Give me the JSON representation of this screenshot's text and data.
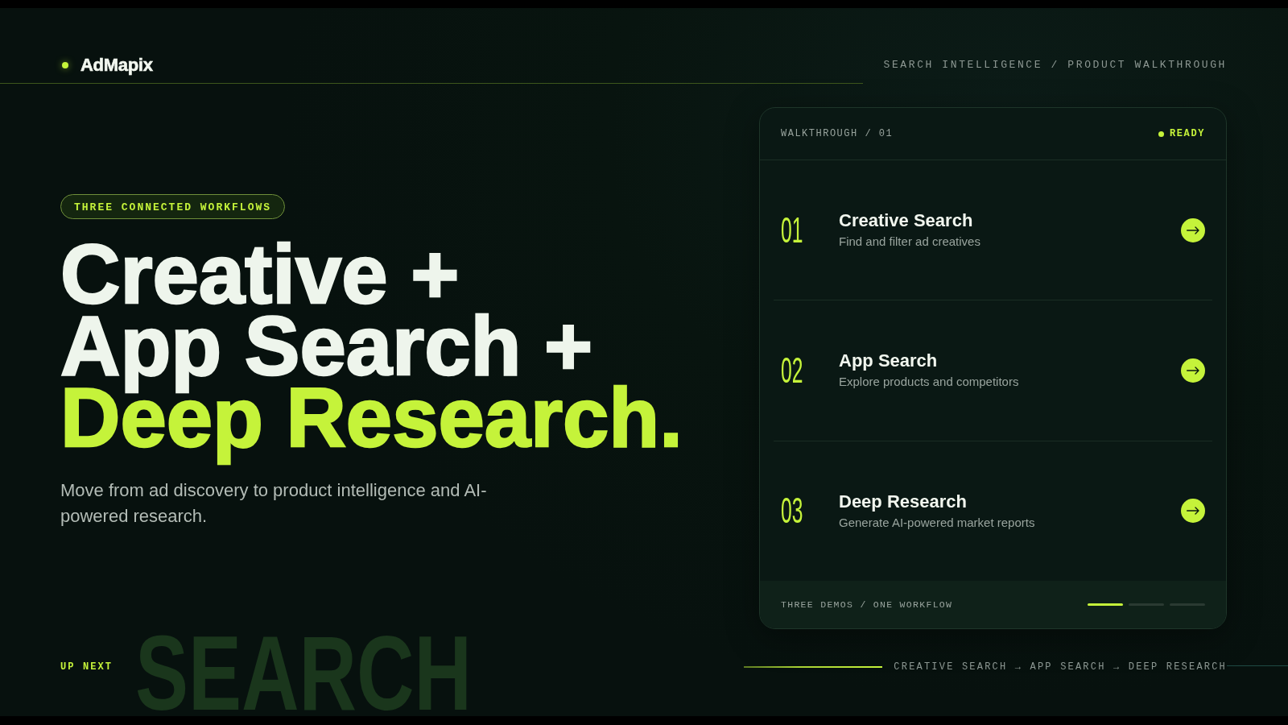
{
  "header": {
    "logo": "AdMapix",
    "section_label": "SEARCH INTELLIGENCE / PRODUCT WALKTHROUGH"
  },
  "hero": {
    "badge": "THREE CONNECTED WORKFLOWS",
    "headline": [
      {
        "text": "Creative +",
        "kind": "plain"
      },
      {
        "text": "App Search +",
        "kind": "plain"
      },
      {
        "text": "Deep Research.",
        "kind": "accent"
      }
    ],
    "description": "Move from ad discovery to product intelligence and AI-powered research."
  },
  "walkthrough_card": {
    "label": "WALKTHROUGH / 01",
    "status": "READY",
    "steps": [
      {
        "number": "01",
        "title": "Creative Search",
        "description": "Find and filter ad creatives"
      },
      {
        "number": "02",
        "title": "App Search",
        "description": "Explore products and competitors"
      },
      {
        "number": "03",
        "title": "Deep Research",
        "description": "Generate AI-powered market reports"
      }
    ],
    "footer_label": "THREE DEMOS / ONE WORKFLOW",
    "pager": [
      {
        "selected": true
      },
      {
        "selected": false
      },
      {
        "selected": false
      }
    ]
  },
  "footer": {
    "label": "UP NEXT",
    "background_word": "SEARCH",
    "sequence": "CREATIVE SEARCH → APP SEARCH → DEEP RESEARCH"
  }
}
